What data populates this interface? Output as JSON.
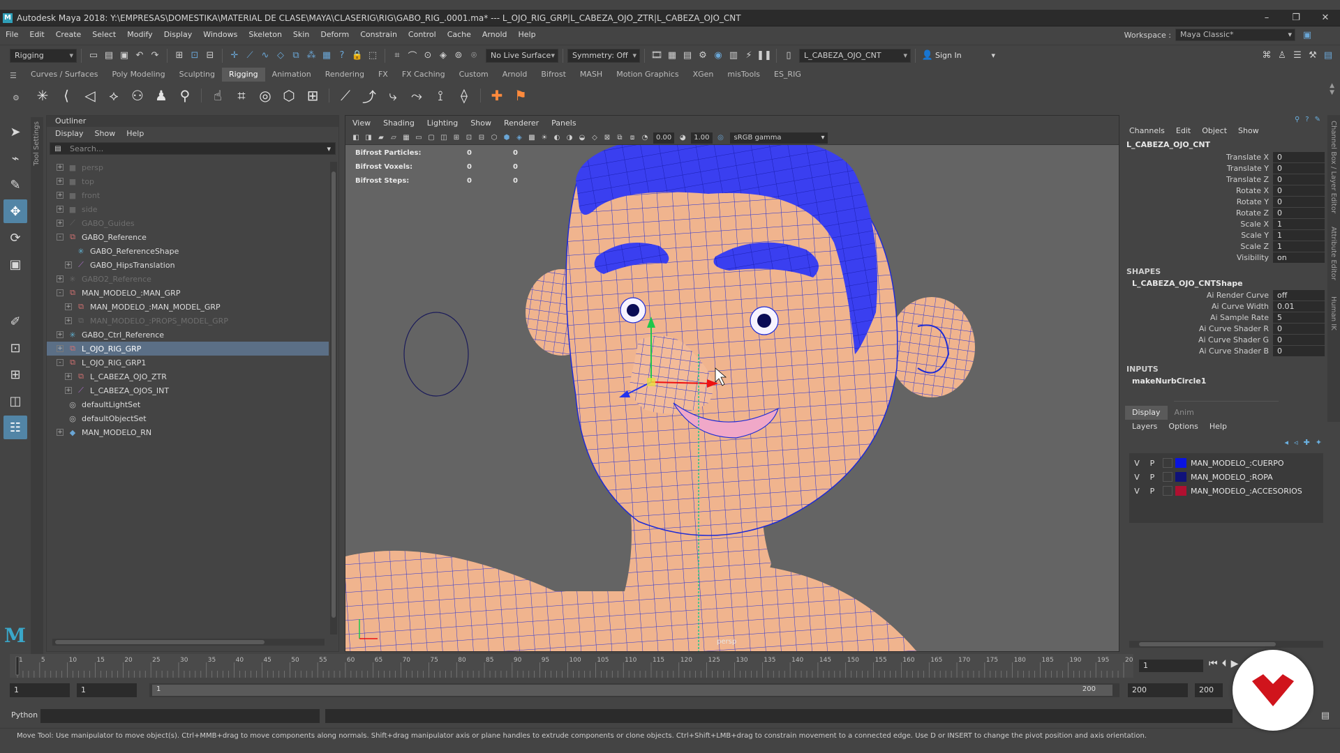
{
  "title_bar": {
    "text": "Autodesk Maya 2018: Y:\\EMPRESAS\\DOMESTIKA\\MATERIAL DE CLASE\\MAYA\\CLASERIG\\RIG\\GABO_RIG_.0001.ma*   ---   L_OJO_RIG_GRP|L_CABEZA_OJO_ZTR|L_CABEZA_OJO_CNT",
    "minimize": "–",
    "maximize": "❐",
    "close": "✕"
  },
  "menu": {
    "items": [
      "File",
      "Edit",
      "Create",
      "Select",
      "Modify",
      "Display",
      "Windows",
      "Skeleton",
      "Skin",
      "Deform",
      "Constrain",
      "Control",
      "Cache",
      "Arnold",
      "Help"
    ],
    "workspace_label": "Workspace :",
    "workspace_value": "Maya Classic*"
  },
  "status_line": {
    "menu_set": "Rigging",
    "live_surface": "No Live Surface",
    "symmetry": "Symmetry: Off",
    "selection_field": "L_CABEZA_OJO_CNT",
    "sign_in": "Sign In"
  },
  "shelf_tabs": [
    "Curves / Surfaces",
    "Poly Modeling",
    "Sculpting",
    "Rigging",
    "Animation",
    "Rendering",
    "FX",
    "FX Caching",
    "Custom",
    "Arnold",
    "Bifrost",
    "MASH",
    "Motion Graphics",
    "XGen",
    "misTools",
    "ES_RIG"
  ],
  "shelf_active_index": 3,
  "tool_settings_label": "Tool Settings",
  "outliner": {
    "title": "Outliner",
    "menu": [
      "Display",
      "Show",
      "Help"
    ],
    "search_placeholder": "Search...",
    "items": [
      {
        "label": "persp",
        "icon": "camera-icon",
        "dim": true,
        "expand": "+",
        "indent": 0
      },
      {
        "label": "top",
        "icon": "camera-icon",
        "dim": true,
        "expand": "+",
        "indent": 0
      },
      {
        "label": "front",
        "icon": "camera-icon",
        "dim": true,
        "expand": "+",
        "indent": 0
      },
      {
        "label": "side",
        "icon": "camera-icon",
        "dim": true,
        "expand": "+",
        "indent": 0
      },
      {
        "label": "GABO_Guides",
        "icon": "joint-icon",
        "dim": true,
        "expand": "+",
        "indent": 0
      },
      {
        "label": "GABO_Reference",
        "icon": "group-icon",
        "dim": false,
        "expand": "-",
        "indent": 0
      },
      {
        "label": "GABO_ReferenceShape",
        "icon": "locator-icon",
        "dim": false,
        "expand": "",
        "indent": 1
      },
      {
        "label": "GABO_HipsTranslation",
        "icon": "joint-icon",
        "dim": false,
        "expand": "+",
        "indent": 1
      },
      {
        "label": "GABO2_Reference",
        "icon": "locator-icon",
        "dim": true,
        "expand": "+",
        "indent": 0
      },
      {
        "label": "MAN_MODELO_:MAN_GRP",
        "icon": "group-icon",
        "dim": false,
        "expand": "-",
        "indent": 0
      },
      {
        "label": "MAN_MODELO_:MAN_MODEL_GRP",
        "icon": "group-icon",
        "dim": false,
        "expand": "+",
        "indent": 1
      },
      {
        "label": "MAN_MODELO_:PROPS_MODEL_GRP",
        "icon": "group-icon",
        "dim": true,
        "expand": "+",
        "indent": 1
      },
      {
        "label": "GABO_Ctrl_Reference",
        "icon": "locator-icon",
        "dim": false,
        "expand": "+",
        "indent": 0
      },
      {
        "label": "L_OJO_RIG_GRP",
        "icon": "group-icon",
        "dim": false,
        "expand": "+",
        "indent": 0,
        "selected": true
      },
      {
        "label": "L_OJO_RIG_GRP1",
        "icon": "group-icon",
        "dim": false,
        "expand": "-",
        "indent": 0
      },
      {
        "label": "L_CABEZA_OJO_ZTR",
        "icon": "group-icon",
        "dim": false,
        "expand": "+",
        "indent": 1
      },
      {
        "label": "L_CABEZA_OJOS_INT",
        "icon": "curve-icon",
        "dim": false,
        "expand": "+",
        "indent": 1
      },
      {
        "label": "defaultLightSet",
        "icon": "set-icon",
        "dim": false,
        "expand": "",
        "indent": 0
      },
      {
        "label": "defaultObjectSet",
        "icon": "set-icon",
        "dim": false,
        "expand": "",
        "indent": 0
      },
      {
        "label": "MAN_MODELO_RN",
        "icon": "reference-icon",
        "dim": false,
        "expand": "+",
        "indent": 0
      }
    ]
  },
  "viewport": {
    "menu": [
      "View",
      "Shading",
      "Lighting",
      "Show",
      "Renderer",
      "Panels"
    ],
    "exposure": "0.00",
    "gamma_value": "1.00",
    "color_space": "sRGB gamma",
    "hud": [
      {
        "label": "Bifrost Particles:",
        "v1": "0",
        "v2": "0"
      },
      {
        "label": "Bifrost Voxels:",
        "v1": "0",
        "v2": "0"
      },
      {
        "label": "Bifrost Steps:",
        "v1": "0",
        "v2": "0"
      }
    ],
    "camera_label": "persp",
    "colors": {
      "skin": "#f0b48e",
      "hair": "#3a3ff0",
      "wire": "#1d2bd6",
      "bg": "#646464"
    }
  },
  "channel_box": {
    "menu": [
      "Channels",
      "Edit",
      "Object",
      "Show"
    ],
    "object_name": "L_CABEZA_OJO_CNT",
    "attributes": [
      {
        "label": "Translate X",
        "value": "0"
      },
      {
        "label": "Translate Y",
        "value": "0"
      },
      {
        "label": "Translate Z",
        "value": "0"
      },
      {
        "label": "Rotate X",
        "value": "0"
      },
      {
        "label": "Rotate Y",
        "value": "0"
      },
      {
        "label": "Rotate Z",
        "value": "0"
      },
      {
        "label": "Scale X",
        "value": "1"
      },
      {
        "label": "Scale Y",
        "value": "1"
      },
      {
        "label": "Scale Z",
        "value": "1"
      },
      {
        "label": "Visibility",
        "value": "on"
      }
    ],
    "shapes_title": "SHAPES",
    "shape_name": "L_CABEZA_OJO_CNTShape",
    "shape_attributes": [
      {
        "label": "Ai Render Curve",
        "value": "off"
      },
      {
        "label": "Ai Curve Width",
        "value": "0.01"
      },
      {
        "label": "Ai Sample Rate",
        "value": "5"
      },
      {
        "label": "Ai Curve Shader R",
        "value": "0"
      },
      {
        "label": "Ai Curve Shader G",
        "value": "0"
      },
      {
        "label": "Ai Curve Shader B",
        "value": "0"
      }
    ],
    "inputs_title": "INPUTS",
    "input_name": "makeNurbCircle1"
  },
  "layer_editor": {
    "tabs": [
      "Display",
      "Anim"
    ],
    "menu": [
      "Layers",
      "Options",
      "Help"
    ],
    "layers": [
      {
        "v": "V",
        "p": "P",
        "color": "#0a14e0",
        "name": "MAN_MODELO_:CUERPO"
      },
      {
        "v": "V",
        "p": "P",
        "color": "#10127a",
        "name": "MAN_MODELO_:ROPA"
      },
      {
        "v": "V",
        "p": "P",
        "color": "#b01030",
        "name": "MAN_MODELO_:ACCESORIOS"
      }
    ]
  },
  "right_tabs": [
    "Channel Box / Layer Editor",
    "Attribute Editor",
    "Human IK"
  ],
  "timeline": {
    "ticks": [
      "5",
      "10",
      "15",
      "20",
      "25",
      "30",
      "35",
      "40",
      "45",
      "50",
      "55",
      "60",
      "65",
      "70",
      "75",
      "80",
      "85",
      "90",
      "95",
      "100",
      "105",
      "110",
      "115",
      "120",
      "125",
      "130",
      "135",
      "140",
      "145",
      "150",
      "155",
      "160",
      "165",
      "170",
      "175",
      "180",
      "185",
      "190",
      "195",
      "20"
    ],
    "first_tick": "1",
    "current_frame": "1",
    "range_start": "1",
    "range_inner_start": "1",
    "range_slider_start": "1",
    "range_slider_end": "200",
    "range_inner_end": "200",
    "range_end": "200"
  },
  "command_line": {
    "label": "Python"
  },
  "help_line": "Move Tool: Use manipulator to move object(s). Ctrl+MMB+drag to move components along normals. Shift+drag manipulator axis or plane handles to extrude components or clone objects. Ctrl+Shift+LMB+drag to constrain movement to a connected edge. Use D or INSERT to change the pivot position and axis orientation."
}
